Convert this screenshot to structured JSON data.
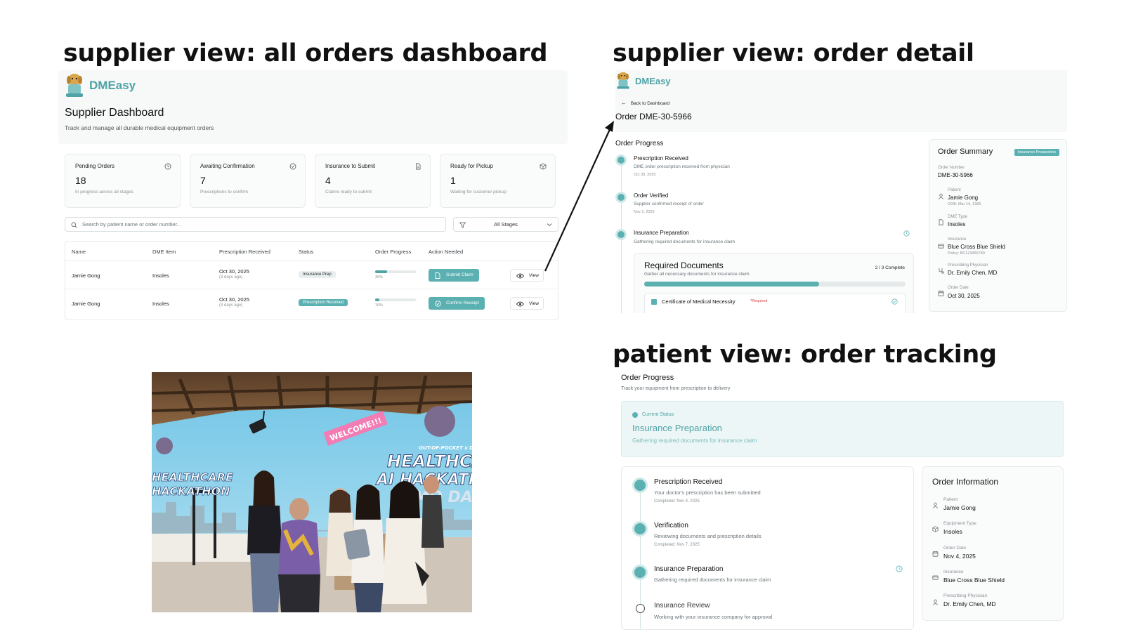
{
  "headings": {
    "dashboard": "supplier view: all orders dashboard",
    "detail": "supplier view: order detail",
    "tracking": "patient view: order tracking"
  },
  "dashboard": {
    "brand": "DMEasy",
    "title": "Supplier Dashboard",
    "subtitle": "Track and manage all durable medical equipment orders",
    "stats": [
      {
        "label": "Pending Orders",
        "value": "18",
        "sub": "In progress across all stages",
        "icon": "clock-icon"
      },
      {
        "label": "Awaiting Confirmation",
        "value": "7",
        "sub": "Prescriptions to confirm",
        "icon": "check-circle-icon"
      },
      {
        "label": "Insurance to Submit",
        "value": "4",
        "sub": "Claims ready to submit",
        "icon": "document-icon"
      },
      {
        "label": "Ready for Pickup",
        "value": "1",
        "sub": "Waiting for customer pickup",
        "icon": "package-icon"
      }
    ],
    "search_placeholder": "Search by patient name or order number...",
    "stage_filter": "All Stages",
    "columns": [
      "Name",
      "DME Item",
      "Prescription Received",
      "Status",
      "Order Progress",
      "Action Needed"
    ],
    "rows": [
      {
        "name": "Jamie Gong",
        "item": "Insoles",
        "date": "Oct 30, 2025",
        "ago": "(3 days ago)",
        "status": "Insurance Prep",
        "progress": 30,
        "progress_label": "30%",
        "action": "Submit Claim",
        "view": "View"
      },
      {
        "name": "Jamie Gong",
        "item": "Insoles",
        "date": "Oct 30, 2025",
        "ago": "(3 days ago)",
        "status": "Prescription Received",
        "progress": 10,
        "progress_label": "10%",
        "action": "Confirm Receipt",
        "view": "View"
      }
    ]
  },
  "detail": {
    "brand": "DMEasy",
    "back": "Back to Dashboard",
    "order_title": "Order DME-30-5966",
    "progress_title": "Order Progress",
    "steps": [
      {
        "title": "Prescription Received",
        "desc": "DME order prescription received from physician",
        "date": "Oct 30, 2025"
      },
      {
        "title": "Order Verified",
        "desc": "Supplier confirmed receipt of order",
        "date": "Nov 2, 2025"
      },
      {
        "title": "Insurance Preparation",
        "desc": "Gathering required documents for insurance claim",
        "date": ""
      }
    ],
    "required_docs": {
      "title": "Required Documents",
      "subtitle": "Gather all necessary documents for insurance claim",
      "count": "2 / 3 Complete",
      "progress": 0.67,
      "item": "Certificate of Medical Necessity",
      "required": "*Required"
    },
    "summary": {
      "title": "Order Summary",
      "badge": "Insurance Preparation",
      "order_number_label": "Order Number",
      "order_number": "DME-30-5966",
      "patient_label": "Patient",
      "patient": "Jamie Gong",
      "dob": "DOB: Mar 14, 1985",
      "dme_label": "DME Type",
      "dme": "Insoles",
      "insurance_label": "Insurance",
      "insurance": "Blue Cross Blue Shield",
      "policy": "Policy: BC123456789",
      "physician_label": "Prescribing Physician",
      "physician": "Dr. Emily Chen, MD",
      "order_date_label": "Order Date",
      "order_date": "Oct 30, 2025"
    }
  },
  "tracking": {
    "title": "Order Progress",
    "subtitle": "Track your equipment from prescription to delivery",
    "current_label": "Current Status",
    "current_status": "Insurance Preparation",
    "current_desc": "Gathering required documents for insurance claim",
    "steps": [
      {
        "title": "Prescription Received",
        "desc": "Your doctor's prescription has been submitted",
        "date": "Completed: Nov 4, 2025"
      },
      {
        "title": "Verification",
        "desc": "Reviewing documents and prescription details",
        "date": "Completed: Nov 7, 2025"
      },
      {
        "title": "Insurance Preparation",
        "desc": "Gathering required documents for insurance claim",
        "date": ""
      },
      {
        "title": "Insurance Review",
        "desc": "Working with your insurance company for approval",
        "date": ""
      }
    ],
    "info": {
      "title": "Order Information",
      "patient_label": "Patient",
      "patient": "Jamie Gong",
      "equipment_label": "Equipment Type",
      "equipment": "Insoles",
      "order_date_label": "Order Date",
      "order_date": "Nov 4, 2025",
      "insurance_label": "Insurance",
      "insurance": "Blue Cross Blue Shield",
      "physician_label": "Prescribing Physician",
      "physician": "Dr. Emily Chen, MD"
    }
  },
  "photo": {
    "banner_welcome": "WELCOME!!!",
    "sign_line1": "OUT-OF-POCKET x DEERFIELD",
    "sign_line2": "HEALTHCARE",
    "sign_line3": "AI HACKATHON",
    "sign_line4": "DEMO DAY",
    "left_sign1": "HEALTHCARE",
    "left_sign2": "HACKATHON"
  },
  "colors": {
    "accent": "#4fa3a5",
    "accent_light": "#5bb0b2",
    "status_bg": "#edf6f6"
  }
}
